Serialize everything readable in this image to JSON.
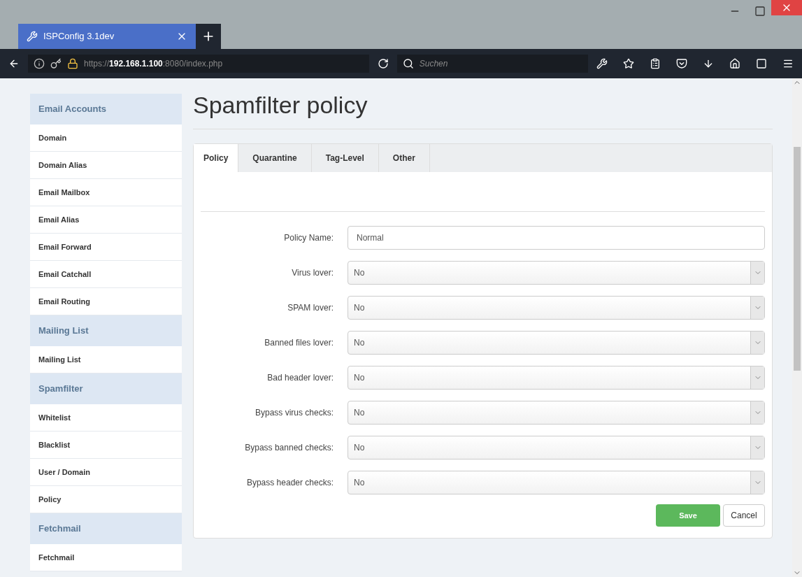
{
  "browser": {
    "tab_title": "ISPConfig 3.1dev",
    "url": "https://**192.168.1.100**:8080/index.php",
    "search_placeholder": "Suchen"
  },
  "sidebar": [
    {
      "heading": "Email Accounts",
      "items": [
        "Domain",
        "Domain Alias",
        "Email Mailbox",
        "Email Alias",
        "Email Forward",
        "Email Catchall",
        "Email Routing"
      ]
    },
    {
      "heading": "Mailing List",
      "items": [
        "Mailing List"
      ]
    },
    {
      "heading": "Spamfilter",
      "items": [
        "Whitelist",
        "Blacklist",
        "User / Domain",
        "Policy"
      ]
    },
    {
      "heading": "Fetchmail",
      "items": [
        "Fetchmail"
      ]
    }
  ],
  "page_title": "Spamfilter policy",
  "tabs": [
    {
      "label": "Policy",
      "selected": true
    },
    {
      "label": "Quarantine",
      "selected": false
    },
    {
      "label": "Tag-Level",
      "selected": false
    },
    {
      "label": "Other",
      "selected": false
    }
  ],
  "fields": [
    {
      "label": "Policy Name:",
      "kind": "text",
      "value": "Normal"
    },
    {
      "label": "Virus lover:",
      "kind": "select",
      "value": "No"
    },
    {
      "label": "SPAM lover:",
      "kind": "select",
      "value": "No"
    },
    {
      "label": "Banned files lover:",
      "kind": "select",
      "value": "No"
    },
    {
      "label": "Bad header lover:",
      "kind": "select",
      "value": "No"
    },
    {
      "label": "Bypass virus checks:",
      "kind": "select",
      "value": "No"
    },
    {
      "label": "Bypass banned checks:",
      "kind": "select",
      "value": "No"
    },
    {
      "label": "Bypass header checks:",
      "kind": "select",
      "value": "No"
    }
  ],
  "buttons": {
    "save": "Save",
    "cancel": "Cancel"
  }
}
